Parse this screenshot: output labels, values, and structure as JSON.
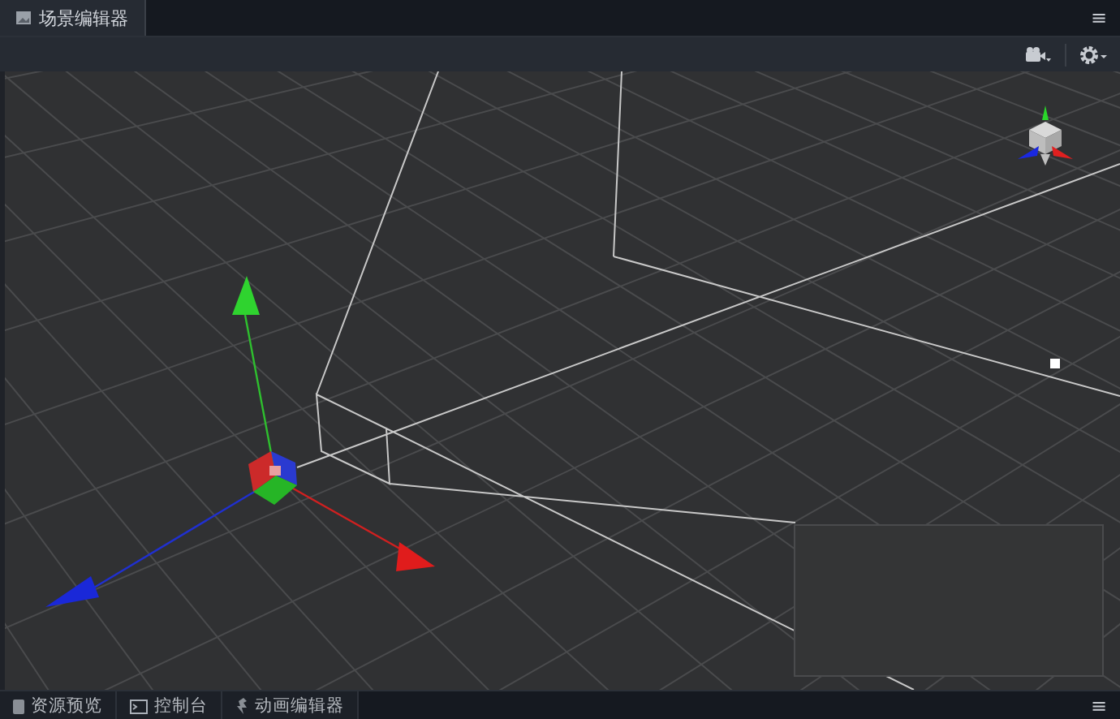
{
  "top_tabs": [
    {
      "label": "场景编辑器",
      "selected": true
    }
  ],
  "toolbar": {
    "menu_icon": "≡"
  },
  "bottom_tabs": [
    {
      "label": "资源预览",
      "selected": false
    },
    {
      "label": "控制台",
      "selected": false
    },
    {
      "label": "动画编辑器",
      "selected": false
    }
  ],
  "bottom_menu_icon": "≡"
}
